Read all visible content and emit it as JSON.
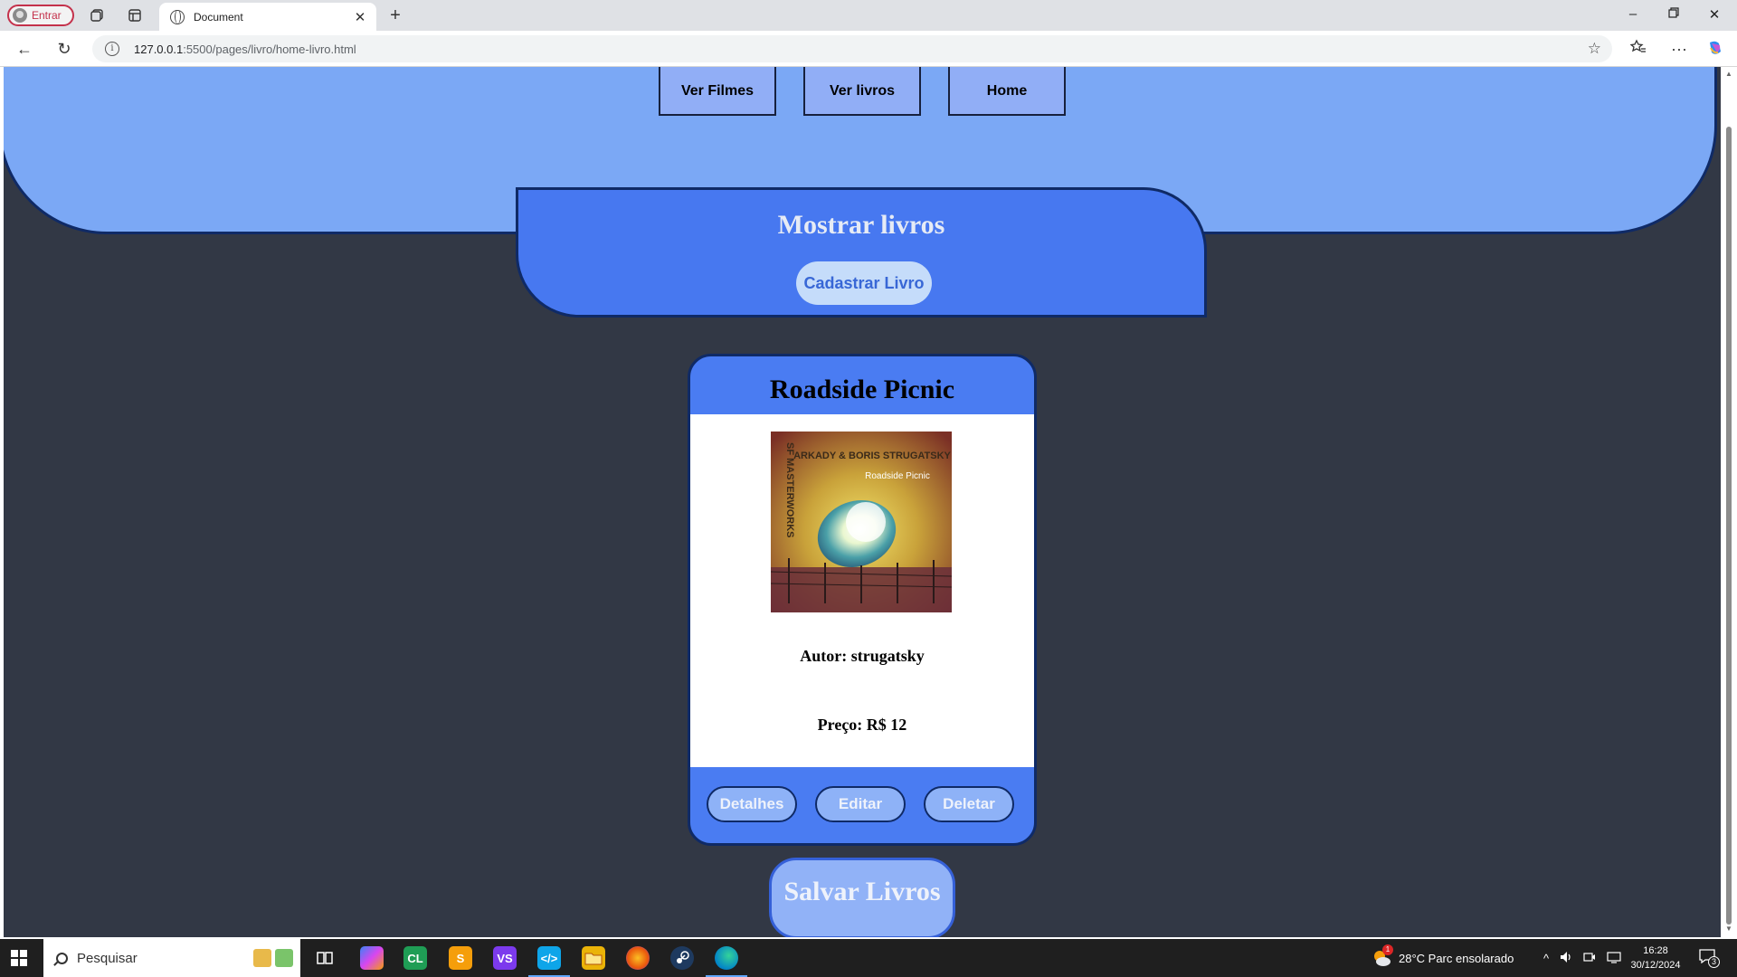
{
  "browser": {
    "profile_label": "Entrar",
    "tab_title": "Document",
    "url_host": "127.0.0.1",
    "url_rest": ":5500/pages/livro/home-livro.html"
  },
  "nav": {
    "links": [
      {
        "label": "Ver Filmes"
      },
      {
        "label": "Ver livros"
      },
      {
        "label": "Home"
      }
    ]
  },
  "section": {
    "title": "Mostrar livros",
    "add_button": "Cadastrar Livro"
  },
  "book": {
    "title": "Roadside Picnic",
    "author": "Autor: strugatsky",
    "price": "Preço: R$ 12",
    "cover_texts": {
      "series": "SF MASTERWORKS",
      "authors": "ARKADY & BORIS STRUGATSKY",
      "book": "Roadside Picnic"
    },
    "actions": {
      "details": "Detalhes",
      "edit": "Editar",
      "delete": "Deletar"
    }
  },
  "save_button": "Salvar Livros",
  "taskbar": {
    "search_placeholder": "Pesquisar",
    "weather": "28°C  Parc ensolarado",
    "time": "16:28",
    "date": "30/12/2024",
    "notification_count": "3",
    "weather_badge": "1"
  },
  "colors": {
    "page_bg": "#323845",
    "header_bg": "#7ba8f5",
    "section_bg": "#4778f0",
    "card_bg": "#4a7cf2",
    "border": "#0f2a66"
  }
}
